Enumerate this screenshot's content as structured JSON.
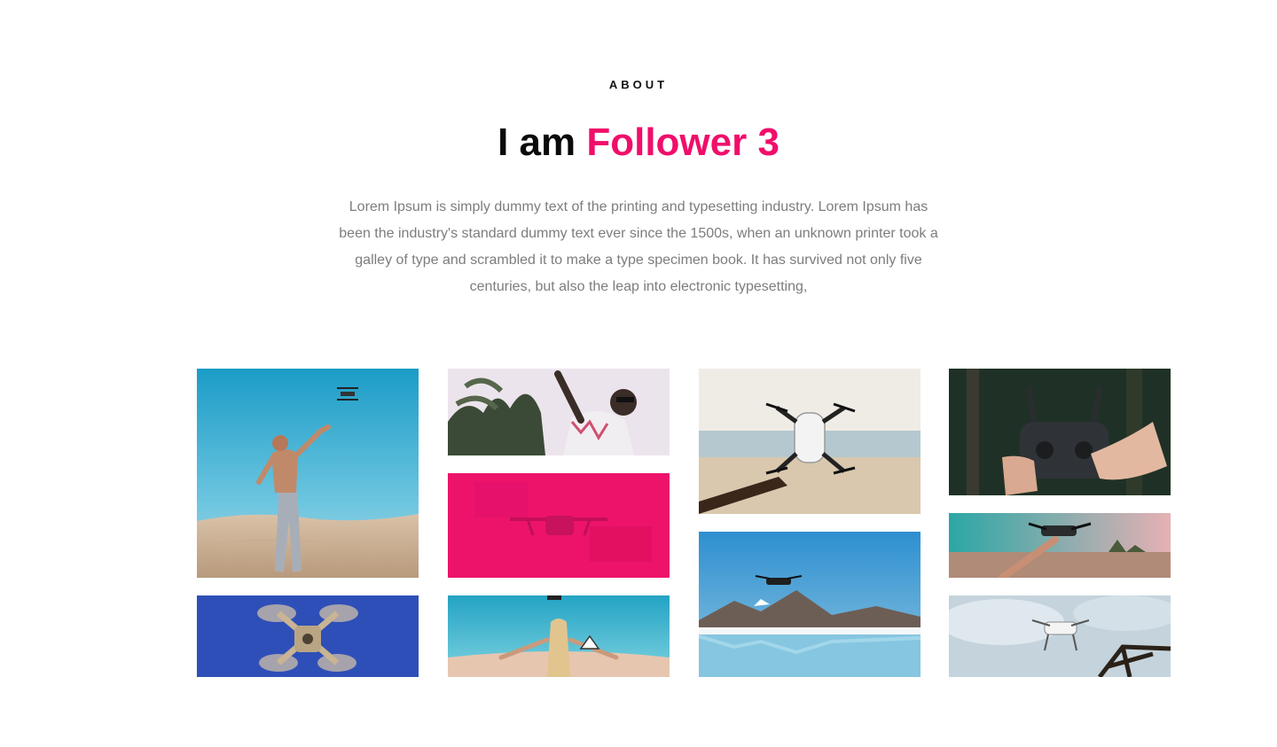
{
  "about": {
    "eyebrow": "ABOUT",
    "title_prefix": "I am ",
    "title_accent": "Follower 3",
    "paragraph": "Lorem Ipsum is simply dummy text of the printing and typesetting industry. Lorem Ipsum has been the industry's standard dummy text ever since the 1500s, when an unknown printer took a galley of type and scrambled it to make a type specimen book. It has survived not only five centuries, but also the leap into electronic typesetting,"
  },
  "colors": {
    "accent": "#f00e6a",
    "heading": "#0a0a0a",
    "body_text": "#7d7d7d"
  },
  "gallery": {
    "photos": [
      "man-launching-drone-in-desert",
      "drone-seen-from-below-blue-sky",
      "person-reaching-under-palm-trees",
      "drone-with-pink-overlay",
      "woman-with-arms-spread-at-beach",
      "hand-holding-white-drone-at-beach",
      "drone-over-mountain-lake",
      "hands-on-drone-remote-controller",
      "hand-holding-drone-at-sunset",
      "drone-flying-near-tower-cloudy-sky"
    ]
  }
}
